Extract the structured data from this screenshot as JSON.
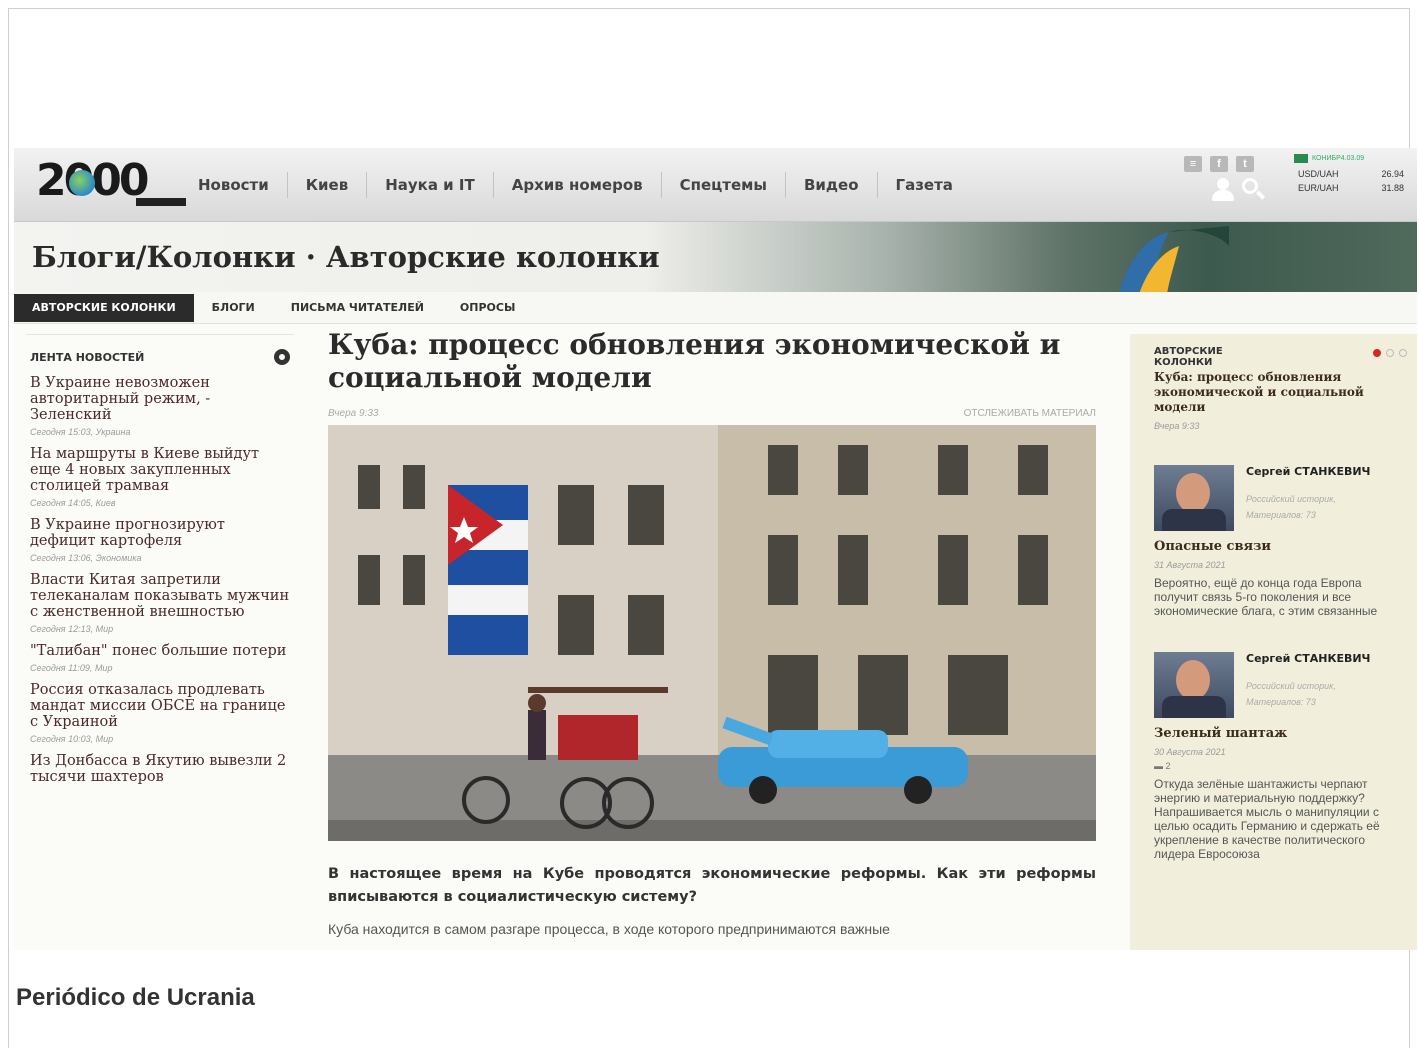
{
  "header": {
    "logo": "2000",
    "nav": [
      "Новости",
      "Киев",
      "Наука и IT",
      "Архив номеров",
      "Спецтемы",
      "Видео",
      "Газета"
    ],
    "social": [
      "rss-icon",
      "facebook-icon",
      "twitter-icon"
    ],
    "rates": {
      "bank": "КОНИБР4.03.09",
      "rows": [
        {
          "pair": "USD/UAH",
          "value": "26.94"
        },
        {
          "pair": "EUR/UAH",
          "value": "31.88"
        }
      ]
    }
  },
  "banner": {
    "title": "Блоги/Колонки · Авторские колонки"
  },
  "tabs": [
    "АВТОРСКИЕ КОЛОНКИ",
    "БЛОГИ",
    "ПИСЬМА ЧИТАТЕЛЕЙ",
    "ОПРОСЫ"
  ],
  "left": {
    "heading": "ЛЕНТА НОВОСТЕЙ",
    "items": [
      {
        "title": "В Украине невозможен авторитарный режим, - Зеленский",
        "meta": "Сегодня 15:03, Украина"
      },
      {
        "title": "На маршруты в Киеве выйдут еще 4 новых закупленных столицей трамвая",
        "meta": "Сегодня 14:05, Киев"
      },
      {
        "title": "В Украине прогнозируют дефицит картофеля",
        "meta": "Сегодня 13:06, Экономика"
      },
      {
        "title": "Власти Китая запретили телеканалам показывать мужчин с женственной внешностью",
        "meta": "Сегодня 12:13, Мир"
      },
      {
        "title": "\"Талибан\" понес большие потери",
        "meta": "Сегодня 11:09, Мир"
      },
      {
        "title": "Россия отказалась продлевать мандат миссии ОБСЕ на границе с Украиной",
        "meta": "Сегодня 10:03, Мир"
      },
      {
        "title": "Из Донбасса в Якутию вывезли 2 тысячи шахтеров",
        "meta": ""
      }
    ]
  },
  "article": {
    "headline": "Куба: процесс обновления экономической и социальной модели",
    "date": "Вчера 9:33",
    "follow": "ОТСЛЕЖИВАТЬ МАТЕРИАЛ",
    "lead": "В настоящее время на Кубе проводятся экономические реформы. Как эти реформы вписываются в социалистическую систему?",
    "body": "Куба находится в самом разгаре процесса, в ходе которого предпринимаются важные"
  },
  "right": {
    "category": "АВТОРСКИЕ КОЛОНКИ",
    "feature_title": "Куба: процесс обновления экономической и социальной модели",
    "feature_date": "Вчера 9:33",
    "cards": [
      {
        "author": "Сергей СТАНКЕВИЧ",
        "role": "Российский историк,",
        "materials": "Материалов: 73",
        "title": "Опасные связи",
        "date": "31 Августа 2021",
        "count": "",
        "text": "Вероятно, ещё до конца года Европа получит связь 5-го поколения и все экономические блага, с этим связанные"
      },
      {
        "author": "Сергей СТАНКЕВИЧ",
        "role": "Российский историк,",
        "materials": "Материалов: 73",
        "title": "Зеленый шантаж",
        "date": "30 Августа 2021",
        "count": "2",
        "text": "Откуда зелёные шантажисты черпают энергию и материальную поддержку? Напрашивается мысль о манипуляции с целью осадить Германию и сдержать её укрепление в качестве политического лидера Евросоюза"
      }
    ]
  },
  "caption": "Periódico de Ucrania",
  "colors": {
    "accent": "#d62828",
    "dark_tab": "#2b2b2b",
    "sidebar_bg": "#f1efdc"
  }
}
